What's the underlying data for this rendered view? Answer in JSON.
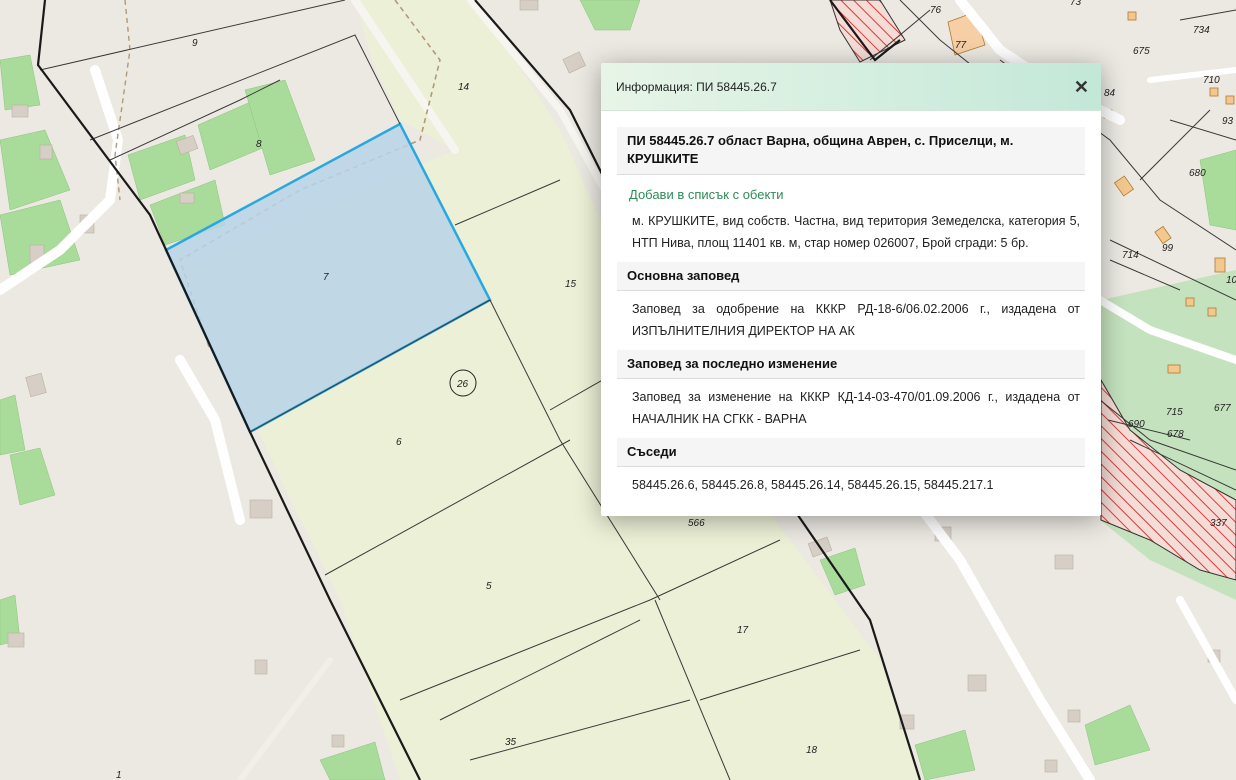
{
  "popup": {
    "title": "Информация: ПИ 58445.26.7",
    "close_icon": "close-icon",
    "heading": "ПИ 58445.26.7 област Варна, община Аврен, с. Приселци, м. КРУШКИТЕ",
    "add_link": "Добави в списък с обекти",
    "details": "м. КРУШКИТЕ, вид собств. Частна, вид територия Земеделска, категория 5, НТП Нива, площ 11401 кв. м, стар номер 026007, Брой сгради: 5 бр.",
    "sections": [
      {
        "title": "Основна заповед",
        "text": "Заповед за одобрение на КККР РД-18-6/06.02.2006 г., издадена от ИЗПЪЛНИТЕЛНИЯ ДИРЕКТОР НА АК"
      },
      {
        "title": "Заповед за последно изменение",
        "text": "Заповед за изменение на КККР КД-14-03-470/01.09.2006 г., издадена от НАЧАЛНИК НА СГКК - ВАРНА"
      },
      {
        "title": "Съседи",
        "text": "58445.26.6, 58445.26.8, 58445.26.14, 58445.26.15, 58445.217.1"
      }
    ]
  },
  "map": {
    "colors": {
      "selected_fill": "#b8d4e8",
      "selected_border": "#29a8e0",
      "agri_fill": "#ebf0d6",
      "green": "#a9dc9a",
      "hatch": "#e03a3a"
    },
    "parcel_labels": [
      "9",
      "14",
      "8",
      "7",
      "15",
      "26",
      "6",
      "5",
      "566",
      "17",
      "35",
      "18",
      "1",
      "76",
      "77",
      "73",
      "734",
      "675",
      "710",
      "84",
      "93",
      "680",
      "99",
      "714",
      "10",
      "715",
      "677",
      "690",
      "678",
      "337"
    ],
    "selected_parcel": "7"
  }
}
